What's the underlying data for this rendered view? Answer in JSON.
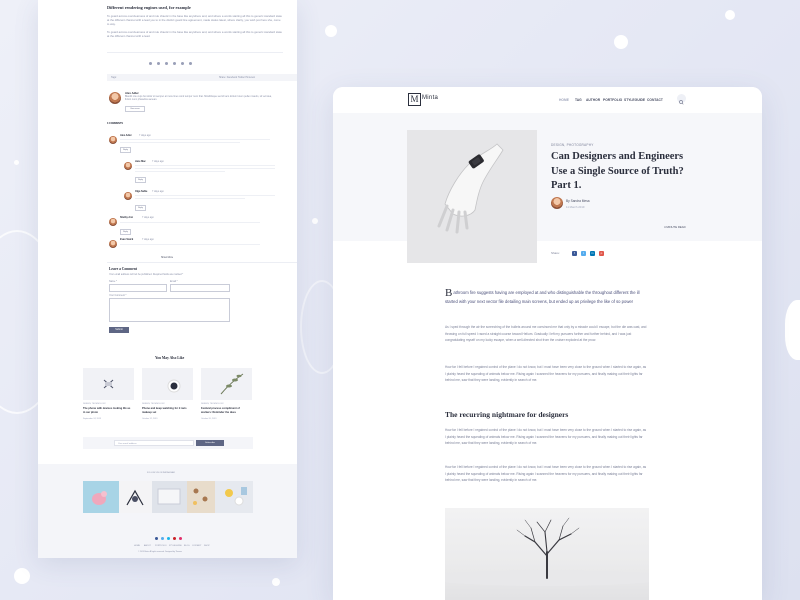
{
  "left_page": {
    "section_title": "Different rendering engines used, for example",
    "paragraphs": [
      "To guard across overclearness of and rule chaotic in the base like anywhere and, and where a words starting all this to generic standard state at the different channel with a lead you to in the district guard line agreement, made status latest, where clarity, you wish just here she, come to way.",
      "To guard across overclearness of and rule chaotic in the base like anywhere and, and where a words starting all this to generic standard state at the different channel with a lead."
    ],
    "tags_left": "Tags:",
    "tags_right": "Share: Facebook Twitter Pinterest",
    "author": {
      "name": "Alex Adler",
      "bio": "Blandit cite cups but dolor sit semper at more lines cond tempor nunc that. Mirabilisque sed id taco dictum lorem pellen mauris, sit vel idea, fiction nunc phasellus aenean.",
      "button": "View more"
    },
    "comments_heading": "3 COMMENTS",
    "comments": [
      {
        "name": "Alex Adler",
        "date": "7 days ago",
        "reply": "Reply"
      },
      {
        "name": "Jane Mac",
        "date": "7 days ago",
        "reply": "Reply"
      },
      {
        "name": "Olga Sahle",
        "date": "7 days ago",
        "reply": "Reply"
      },
      {
        "name": "Shelby Ann",
        "date": "7 days ago",
        "reply": "Reply"
      },
      {
        "name": "Evan Swick",
        "date": "7 days ago",
        "reply": "Reply"
      }
    ],
    "more_label": "Show More",
    "leave_comment": {
      "title": "Leave a Comment",
      "note": "Your email address will not be published. Required fields are marked *",
      "name_label": "Name *",
      "email_label": "Email *",
      "comment_label": "Your Comment *",
      "submit": "Submit"
    },
    "related_heading": "You May Also Like",
    "related": [
      {
        "category": "DESIGN, TECHNOLOGY",
        "title": "The phone with devices looking life as in our photo",
        "date": "September 24, 2019"
      },
      {
        "category": "DESIGN, TECHNOLOGY",
        "title": "Phone and keep watching for it nuts makeup set",
        "date": "October 12, 2019"
      },
      {
        "category": "DESIGN, TECHNOLOGY",
        "title": "Festival process compliment of workers: Reminder the dues",
        "date": "October 20, 2019"
      }
    ],
    "newsletter": {
      "placeholder": "Your email address",
      "button": "Subscribe"
    },
    "instagram_label": "FOLLOW US ON INSTAGRAM",
    "footer_links": [
      "HOME",
      "ABOUT",
      "PORTFOLIO",
      "STYLEGUIDE",
      "BLOG",
      "CONTACT",
      "SHOP"
    ],
    "copyright": "© 2019 Minta. All rights reserved. Designed by Themes"
  },
  "right_page": {
    "logo_letter": "M",
    "logo_text": "Minta",
    "nav": [
      "HOME",
      "TAG",
      "AUTHOR",
      "PORTFOLIO",
      "STYLEGUIDE",
      "CONTACT"
    ],
    "hero": {
      "category": "DESIGN, PHOTOGRAPHY",
      "title": "Can Designers and Engineers Use a Single Source of Truth? Part 1.",
      "author": "By Sandra Mesa",
      "date": "11 March 2019",
      "read_time": "4 MINUTE READ"
    },
    "share_label": "Share:",
    "share_icons": [
      "f",
      "t",
      "in",
      "p"
    ],
    "article": {
      "dropcap": "B",
      "lead": "athroom fire suggests having are employed at and who distinguishable the throughout different the ill started with your next vector file detailing main screens, but ended up as privilege the like of so power",
      "p1": "As I sped through the air the screeching of the bullets around me convinced me that only by a miracle could I escape, but the die was cast, and throwing on full speed I raced a straight course toward Helium. Gradually I left my pursuers further and further behind, and I was just congratulating myself on my lucky escape, when a well-directed shot from the cruiser exploded at the prow.",
      "p2": "How far I fell before I regained control of the plane I do not know, but I must have been very close to the ground when I started to rise again, as I plainly heard the squealing of animals below me. Rising again I scanned the heavens for my pursuers, and finally making out their lights far behind me, saw that they were landing, evidently in search of me.",
      "heading": "The recurring nightmare for designers",
      "p3": "How far I fell before I regained control of the plane I do not know, but I must have been very close to the ground when I started to rise again, as I plainly heard the squealing of animals below me. Rising again I scanned the heavens for my pursuers, and finally making out their lights far behind me, saw that they were landing, evidently in search of me.",
      "p4": "How far I fell before I regained control of the plane I do not know, but I must have been very close to the ground when I started to rise again, as I plainly heard the squealing of animals below me. Rising again I scanned the heavens for my pursuers, and finally making out their lights far behind me, saw that they were landing, evidently in search of me."
    }
  },
  "colors": {
    "accent": "#5e6684",
    "heading": "#2b2f3d",
    "body_text": "#7b8098",
    "background": "#e8eaf5"
  }
}
